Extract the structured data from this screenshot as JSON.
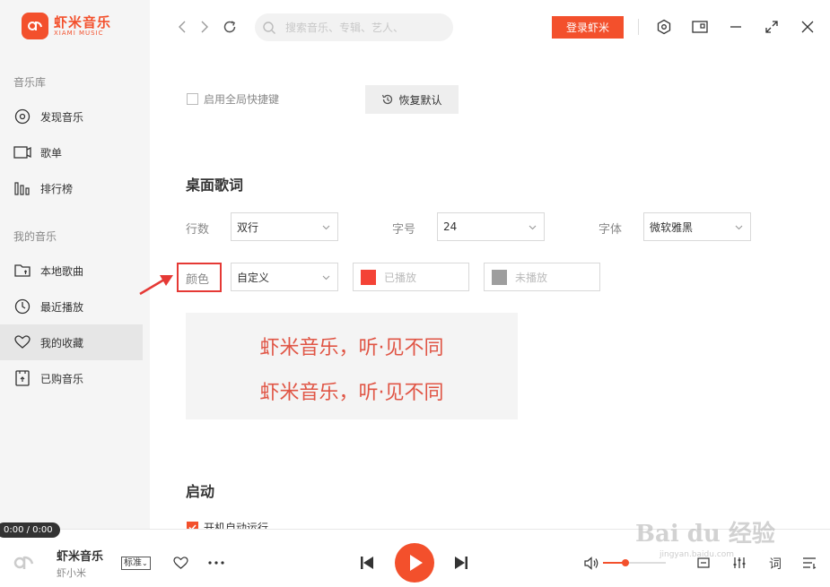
{
  "app": {
    "logo_cn": "虾米音乐",
    "logo_en": "XIAMI MUSIC",
    "logo_mark": "ᑯ"
  },
  "sidebar": {
    "library_title": "音乐库",
    "library_items": [
      {
        "label": "发现音乐",
        "icon": "disc-icon"
      },
      {
        "label": "歌单",
        "icon": "playlist-icon"
      },
      {
        "label": "排行榜",
        "icon": "chart-icon"
      }
    ],
    "my_title": "我的音乐",
    "my_items": [
      {
        "label": "本地歌曲",
        "icon": "folder-icon"
      },
      {
        "label": "最近播放",
        "icon": "clock-icon"
      },
      {
        "label": "我的收藏",
        "icon": "heart-icon",
        "active": true
      },
      {
        "label": "已购音乐",
        "icon": "purchase-icon"
      }
    ]
  },
  "topbar": {
    "search_placeholder": "搜索音乐、专辑、艺人、",
    "login_label": "登录虾米"
  },
  "settings": {
    "global_shortcut_label": "启用全局快捷键",
    "global_shortcut_checked": false,
    "restore_label": "恢复默认",
    "desktop_lyrics": {
      "heading": "桌面歌词",
      "lines_label": "行数",
      "lines_value": "双行",
      "size_label": "字号",
      "size_value": "24",
      "font_label": "字体",
      "font_value": "微软雅黑",
      "color_label": "颜色",
      "color_value": "自定义",
      "played_label": "已播放",
      "played_color": "#f44336",
      "unplayed_label": "未播放",
      "unplayed_color": "#9e9e9e",
      "preview_line1": "虾米音乐，听·见不同",
      "preview_line2": "虾米音乐，听·见不同"
    },
    "startup": {
      "heading": "启动",
      "autostart_label": "开机自动运行",
      "autostart_checked": true
    }
  },
  "player": {
    "time": "0:00 / 0:00",
    "song_title": "虾米音乐",
    "artist": "虾小米",
    "quality": "标准",
    "lyric_button": "词",
    "volume": 0.35
  },
  "watermark": {
    "brand": "Bai du 经验",
    "url": "jingyan.baidu.com"
  },
  "colors": {
    "accent": "#f3502c",
    "sidebar_bg": "#f5f5f5",
    "highlight": "#e53935"
  }
}
